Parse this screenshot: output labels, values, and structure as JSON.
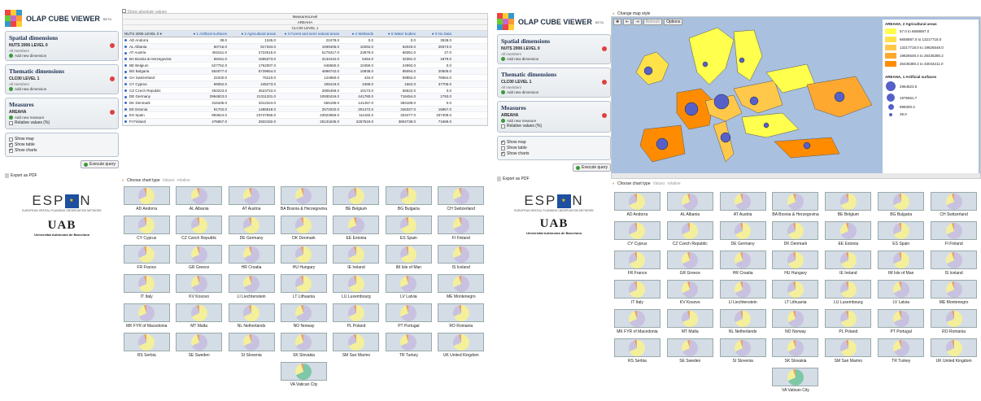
{
  "app": {
    "title": "OLAP CUBE VIEWER",
    "beta": "BETA"
  },
  "spatial": {
    "header": "Spatial dimensions",
    "dim": "NUTS 2006 LEVEL 0",
    "members": "All members",
    "add": "Add new dimension"
  },
  "thematic": {
    "header": "Thematic dimensions",
    "dim": "CLC00 LEVEL 1",
    "members": "All members",
    "add": "Add new dimension"
  },
  "measures": {
    "header": "Measures",
    "measure": "AREAHA",
    "add": "Add new measure",
    "relative": "Relative values (%)"
  },
  "options": {
    "show_map": "Show map",
    "show_table": "Show table",
    "show_charts": "Show charts"
  },
  "execute": "Execute query",
  "export": "Export as PDF",
  "espon": {
    "word_left": "ESP",
    "word_right": "N",
    "sub": "EUROPEAN SPATIAL PLANNING OBSERVATION NETWORK"
  },
  "uab": {
    "word": "UAB",
    "sub": "Universitat Autònoma de Barcelona"
  },
  "table": {
    "show_abs": "Show absolute values",
    "h1": "MeasuresLevel",
    "h2": "AREAHA",
    "h3": "CLC00 LEVEL 1",
    "row_header": "NUTS 2006 LEVEL 0",
    "cols": [
      "1 Artificial surfaces",
      "2 Agricultural areas",
      "3 Forest and semi natural areas",
      "4 Wetlands",
      "5 Water bodies",
      "0 No Data"
    ],
    "rows": [
      [
        "AD Andorra",
        "39.0",
        "1345.0",
        "22478.0",
        "0.0",
        "0.0",
        "3538.0"
      ],
      [
        "AL Albania",
        "50716.0",
        "817334.0",
        "1939405.0",
        "10252.0",
        "62020.0",
        "28373.0"
      ],
      [
        "AT Austria",
        "481511.0",
        "2722515.0",
        "5175317.0",
        "22879.0",
        "68351.0",
        "27.0"
      ],
      [
        "BA Bosnia & Herzegovina",
        "69151.0",
        "1665373.0",
        "3134442.0",
        "5464.0",
        "32391.0",
        "1879.0"
      ],
      [
        "BE Belgium",
        "627752.0",
        "1762007.0",
        "646560.0",
        "10459.0",
        "24992.0",
        "0.0"
      ],
      [
        "BG Bulgaria",
        "554077.0",
        "5739654.0",
        "4696742.0",
        "10938.0",
        "95094.0",
        "20505.0"
      ],
      [
        "CH Switzerland",
        "22340.0",
        "76210.0",
        "124960.0",
        "434.0",
        "59952.0",
        "76564.0"
      ],
      [
        "CY Cyprus",
        "69052.0",
        "445273.0",
        "405419.0",
        "2488.0",
        "1562.0",
        "37706.0"
      ],
      [
        "CZ Czech Republic",
        "493223.0",
        "4523723.0",
        "2805459.0",
        "10173.0",
        "56522.0",
        "0.0"
      ],
      [
        "DE Germany",
        "2964823.0",
        "21311331.0",
        "10930419.0",
        "441780.0",
        "718454.0",
        "1793.0"
      ],
      [
        "DK Denmark",
        "315335.0",
        "3312324.0",
        "555195.0",
        "141457.0",
        "393189.0",
        "0.0"
      ],
      [
        "EE Estonia",
        "91702.0",
        "1485518.0",
        "2572032.0",
        "201472.0",
        "346327.0",
        "16857.0"
      ],
      [
        "ES Spain",
        "893624.0",
        "23747655.0",
        "23923655.0",
        "111182.0",
        "323477.0",
        "337409.0"
      ],
      [
        "FI Finland",
        "475857.0",
        "2922182.0",
        "25131535.0",
        "2257519.0",
        "3804738.0",
        "71669.0"
      ]
    ]
  },
  "chart_ctl": {
    "type": "Choose chart type",
    "values": "Values",
    "relative": "relative"
  },
  "countries": [
    {
      "n": "AD Andorra",
      "c": "#f4ef9a"
    },
    {
      "n": "AL Albania",
      "c": "#c8c2e0"
    },
    {
      "n": "AT Austria",
      "c": "#c8c2e0"
    },
    {
      "n": "BA Bosnia & Herzegovina",
      "c": "#c8c2e0"
    },
    {
      "n": "BE Belgium",
      "c": "#f4ef9a"
    },
    {
      "n": "BG Bulgaria",
      "c": "#f4ef9a"
    },
    {
      "n": "CH Switzerland",
      "c": "#c8c2e0"
    },
    {
      "n": "CY Cyprus",
      "c": "#f4ef9a"
    },
    {
      "n": "CZ Czech Republic",
      "c": "#f4ef9a"
    },
    {
      "n": "DE Germany",
      "c": "#f4ef9a"
    },
    {
      "n": "DK Denmark",
      "c": "#f4ef9a"
    },
    {
      "n": "EE Estonia",
      "c": "#c8c2e0"
    },
    {
      "n": "ES Spain",
      "c": "#f4ef9a"
    },
    {
      "n": "FI Finland",
      "c": "#c8c2e0"
    },
    {
      "n": "FR France",
      "c": "#f4ef9a"
    },
    {
      "n": "GR Greece",
      "c": "#c8c2e0"
    },
    {
      "n": "HR Croatia",
      "c": "#c8c2e0"
    },
    {
      "n": "HU Hungary",
      "c": "#f4ef9a"
    },
    {
      "n": "IE Ireland",
      "c": "#f4ef9a"
    },
    {
      "n": "IM Isle of Man",
      "c": "#f4ef9a"
    },
    {
      "n": "IS Iceland",
      "c": "#c8c2e0"
    },
    {
      "n": "IT Italy",
      "c": "#f4ef9a"
    },
    {
      "n": "KV Kosovo",
      "c": "#c8c2e0"
    },
    {
      "n": "LI Liechtenstein",
      "c": "#c8c2e0"
    },
    {
      "n": "LT Lithuania",
      "c": "#f4ef9a"
    },
    {
      "n": "LU Luxembourg",
      "c": "#f4ef9a"
    },
    {
      "n": "LV Latvia",
      "c": "#c8c2e0"
    },
    {
      "n": "ME Montenegro",
      "c": "#c8c2e0"
    },
    {
      "n": "MK FYR of Macedonia",
      "c": "#c8c2e0"
    },
    {
      "n": "MT Malta",
      "c": "#f4ef9a"
    },
    {
      "n": "NL Netherlands",
      "c": "#f4ef9a"
    },
    {
      "n": "NO Norway",
      "c": "#c8c2e0"
    },
    {
      "n": "PL Poland",
      "c": "#f4ef9a"
    },
    {
      "n": "PT Portugal",
      "c": "#c8c2e0"
    },
    {
      "n": "RO Romania",
      "c": "#f4ef9a"
    },
    {
      "n": "RS Serbia",
      "c": "#f4ef9a"
    },
    {
      "n": "SE Sweden",
      "c": "#c8c2e0"
    },
    {
      "n": "SI Slovenia",
      "c": "#c8c2e0"
    },
    {
      "n": "SK Slovakia",
      "c": "#c8c2e0"
    },
    {
      "n": "SM San Marino",
      "c": "#f4ef9a"
    },
    {
      "n": "TR Turkey",
      "c": "#c8c2e0"
    },
    {
      "n": "UK United Kingdom",
      "c": "#f4ef9a"
    },
    {
      "n": "VA Vatican City",
      "c": "#7ec8a8"
    }
  ],
  "map": {
    "style": "Change map style",
    "toolbar": {
      "options": "Options",
      "refresh": "Refresh"
    },
    "legend1": {
      "title": "AREAHA, 2 Agricultural areas",
      "ranges": [
        "57.0  to  6658887.0",
        "6658887.0  to  13217718.0",
        "13217718.0  to  19826548.0",
        "19826548.4  to  26435380.2",
        "26435380.2  to  33044211.0"
      ],
      "colors": [
        "#ffff4d",
        "#ffe24a",
        "#ffc84a",
        "#ffa830",
        "#ff8c00"
      ]
    },
    "legend2": {
      "title": "AREAHA, 1 Artificial surfaces",
      "values": [
        "2964823.0",
        "1976551.7",
        "988300.3",
        "39.0"
      ]
    }
  }
}
